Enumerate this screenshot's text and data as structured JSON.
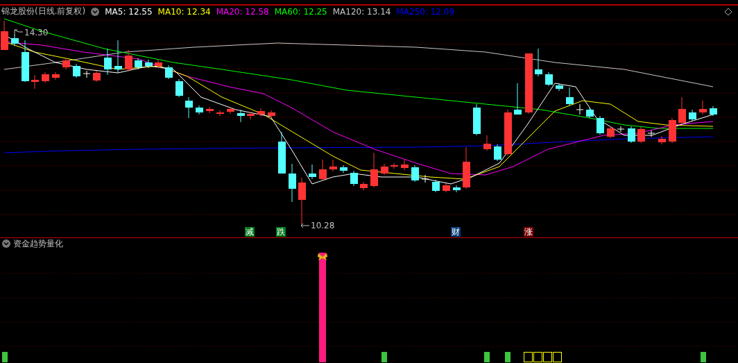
{
  "chart_header": {
    "title": "锦龙股份(日线.前复权)",
    "ma_legend": [
      {
        "label": "MA5: 12.55",
        "color": "#ffffff"
      },
      {
        "label": "MA10: 12.34",
        "color": "#ffff00"
      },
      {
        "label": "MA20: 12.58",
        "color": "#ff00ff"
      },
      {
        "label": "MA60: 12.25",
        "color": "#00ff00"
      },
      {
        "label": "MA120: 13.14",
        "color": "#c8c8c8"
      },
      {
        "label": "MA250: 12.09",
        "color": "#0000ff"
      }
    ]
  },
  "price_chart": {
    "high_label": "14.30",
    "low_label": "10.28",
    "signals": [
      {
        "text": "减",
        "color": "#007a1a"
      },
      {
        "text": "跌",
        "color": "#007a1a"
      },
      {
        "text": "财",
        "color": "#0a3c78"
      },
      {
        "text": "涨",
        "color": "#7a0000"
      }
    ]
  },
  "indicator_panel": {
    "title": "资金趋势量化"
  }
}
